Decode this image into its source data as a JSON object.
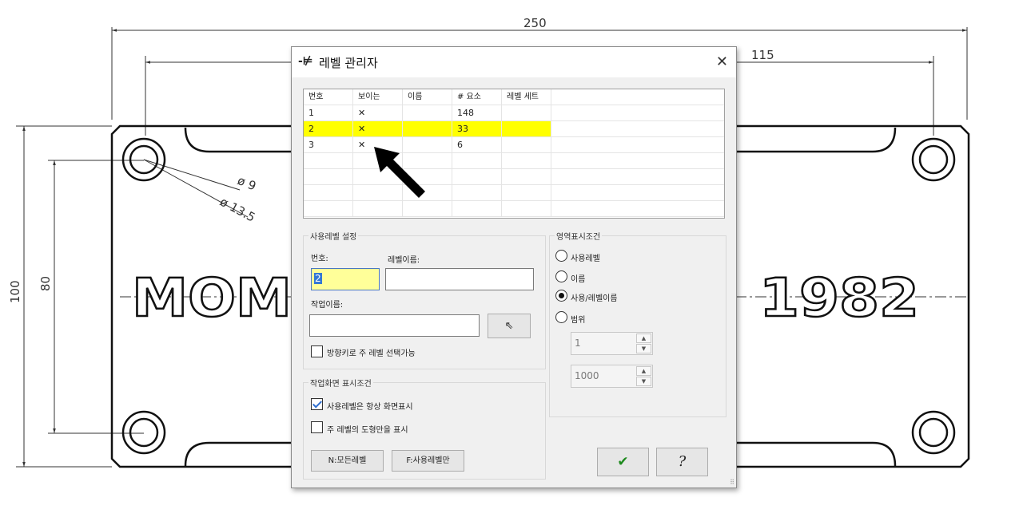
{
  "drawing": {
    "dimensions": {
      "overall_width": "250",
      "hole_offset": "115",
      "overall_height": "100",
      "inner_height": "80",
      "small_dia": "ø 9",
      "large_dia": "ø 13.5"
    },
    "text_left": "MOM",
    "text_right": "1982"
  },
  "dialog": {
    "title": "레벨 관리자",
    "title_icon": "pushpin-icon",
    "close_glyph": "✕",
    "table": {
      "columns": [
        "번호",
        "보이는",
        "이름",
        "# 요소",
        "레벨 세트"
      ],
      "rows": [
        {
          "number": "1",
          "visible": "✕",
          "name": "",
          "count": "148",
          "set": ""
        },
        {
          "number": "2",
          "visible": "✕",
          "name": "",
          "count": "33",
          "set": ""
        },
        {
          "number": "3",
          "visible": "✕",
          "name": "",
          "count": "6",
          "set": ""
        }
      ],
      "selected_row": "2",
      "highlight_color": "#ffff00"
    },
    "level_settings": {
      "legend": "사용레벨 설정",
      "number_label": "번호:",
      "name_label": "레벨이름:",
      "number_value": "2",
      "name_value": "",
      "work_name_label": "작업이름:",
      "work_name_value": "",
      "pick_icon": "cursor-icon",
      "pick_glyph": "⇖",
      "arrow_key_label": "방향키로 주 레벨 선택가능",
      "arrow_key_checked": false
    },
    "display_conditions": {
      "legend": "작업화면 표시조건",
      "always_show_label": "사용레벨은 항상 화면표시",
      "always_show_checked": true,
      "main_only_label": "주 레벨의 도형만을 표시",
      "main_only_checked": false,
      "all_levels_button": "N:모든레벨",
      "used_levels_button": "F:사용레벨만"
    },
    "area_display": {
      "legend": "영역표시조건",
      "options": [
        "사용레벨",
        "이름",
        "사용/레벨이름",
        "범위"
      ],
      "selected": "사용/레벨이름",
      "range_from": "1",
      "range_to": "1000"
    },
    "ok_icon": "checkmark-icon",
    "ok_glyph": "✔",
    "help_icon": "help-icon",
    "help_glyph": "?"
  }
}
